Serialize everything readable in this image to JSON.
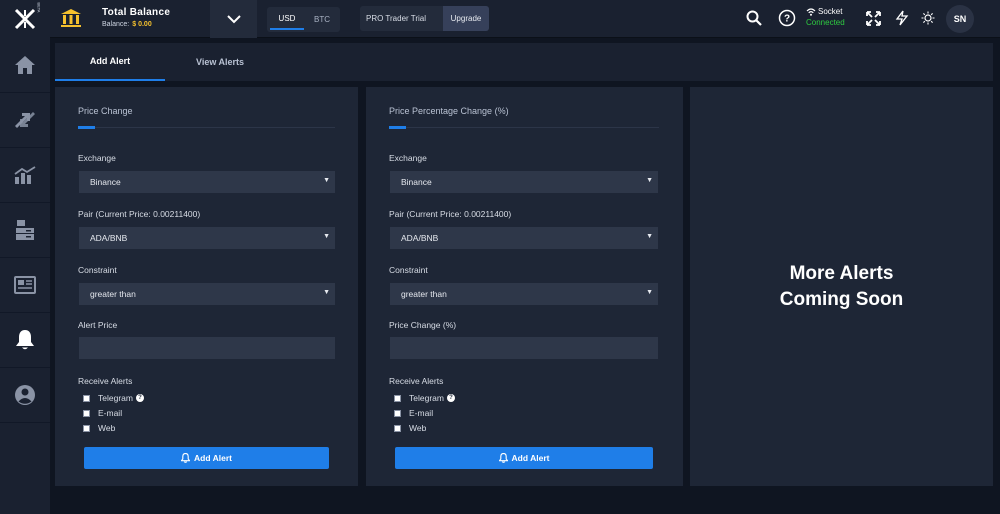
{
  "logo": {
    "beta": "BETA"
  },
  "balance": {
    "title": "Total Balance",
    "label": "Balance:",
    "amount": "$ 0.00"
  },
  "currency": {
    "usd": "USD",
    "btc": "BTC"
  },
  "pro": {
    "label": "PRO Trader Trial",
    "upgrade": "Upgrade"
  },
  "socket": {
    "label": "Socket",
    "status": "Connected"
  },
  "user": {
    "initials": "SN"
  },
  "tabs": {
    "add": "Add Alert",
    "view": "View Alerts"
  },
  "panel_left": {
    "title": "Price Change",
    "exchange_label": "Exchange",
    "exchange_value": "Binance",
    "pair_label": "Pair (Current Price: 0.00211400)",
    "pair_value": "ADA/BNB",
    "constraint_label": "Constraint",
    "constraint_value": "greater than",
    "value_label": "Alert Price",
    "value_input": "",
    "receive_label": "Receive Alerts",
    "telegram": "Telegram",
    "email": "E-mail",
    "web": "Web",
    "button": "Add Alert"
  },
  "panel_right": {
    "title": "Price Percentage Change (%)",
    "exchange_label": "Exchange",
    "exchange_value": "Binance",
    "pair_label": "Pair (Current Price: 0.00211400)",
    "pair_value": "ADA/BNB",
    "constraint_label": "Constraint",
    "constraint_value": "greater than",
    "value_label": "Price Change (%)",
    "value_input": "",
    "receive_label": "Receive Alerts",
    "telegram": "Telegram",
    "email": "E-mail",
    "web": "Web",
    "button": "Add Alert"
  },
  "coming_soon": "More Alerts Coming Soon",
  "colors": {
    "accent": "#1f7ee8",
    "balance": "#f5c12e",
    "connected": "#2ecc40"
  },
  "icons": {
    "sidebar": [
      "home-icon",
      "exchange-arrows-icon",
      "chart-bars-icon",
      "portfolio-icon",
      "news-icon",
      "bell-icon",
      "user-icon"
    ],
    "topbar": [
      "search-icon",
      "help-icon",
      "wifi-icon",
      "expand-icon",
      "lightning-icon",
      "sun-icon"
    ]
  }
}
